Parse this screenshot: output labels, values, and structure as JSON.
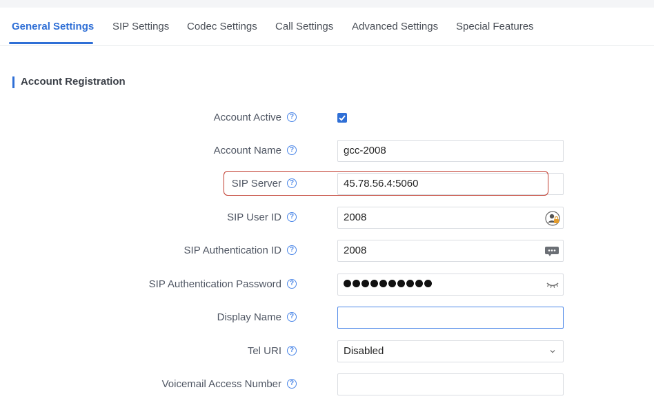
{
  "tabs": [
    {
      "label": "General Settings",
      "active": true
    },
    {
      "label": "SIP Settings"
    },
    {
      "label": "Codec Settings"
    },
    {
      "label": "Call Settings"
    },
    {
      "label": "Advanced Settings"
    },
    {
      "label": "Special Features"
    }
  ],
  "section": {
    "title": "Account Registration"
  },
  "fields": {
    "account_active": {
      "label": "Account Active",
      "checked": true
    },
    "account_name": {
      "label": "Account Name",
      "value": "gcc-2008"
    },
    "sip_server": {
      "label": "SIP Server",
      "value": "45.78.56.4:5060"
    },
    "sip_user_id": {
      "label": "SIP User ID",
      "value": "2008"
    },
    "sip_auth_id": {
      "label": "SIP Authentication ID",
      "value": "2008"
    },
    "sip_auth_password": {
      "label": "SIP Authentication Password",
      "masked_length": 10
    },
    "display_name": {
      "label": "Display Name",
      "value": ""
    },
    "tel_uri": {
      "label": "Tel URI",
      "value": "Disabled"
    },
    "voicemail_access_number": {
      "label": "Voicemail Access Number",
      "value": ""
    }
  },
  "help_glyph": "?",
  "colors": {
    "accent": "#2f6fd6",
    "highlight_border": "#c0392b"
  }
}
